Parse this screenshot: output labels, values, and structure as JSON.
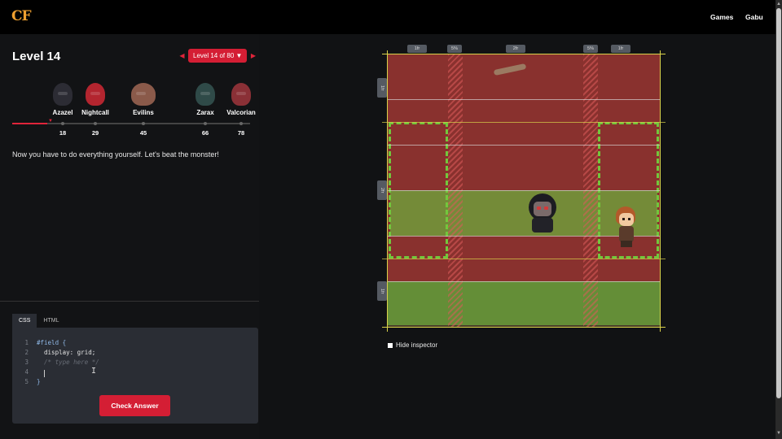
{
  "topbar": {
    "logo": "CF",
    "nav": [
      {
        "label": "Games"
      },
      {
        "label": "Gabu"
      }
    ]
  },
  "level": {
    "title": "Level 14",
    "selector_label": "Level 14 of 80",
    "dropdown_glyph": "▼",
    "prev_glyph": "◀",
    "next_glyph": "▶"
  },
  "bosses": [
    {
      "name": "Azazel",
      "level": "18",
      "color": "#2c2c34"
    },
    {
      "name": "Nightcall",
      "level": "29",
      "color": "#b3252f"
    },
    {
      "name": "Evilins",
      "level": "45",
      "color": "#8a5a4a"
    },
    {
      "name": "Zarax",
      "level": "66",
      "color": "#2f4a48"
    },
    {
      "name": "Valcorian",
      "level": "78",
      "color": "#8a3036"
    }
  ],
  "progress": {
    "current_level": 14,
    "total_levels": 80
  },
  "instructions": "Now you have to do everything yourself. Let's beat the monster!",
  "editor": {
    "tabs": [
      {
        "label": "CSS"
      },
      {
        "label": "HTML"
      }
    ],
    "active_tab": "CSS",
    "lines": [
      {
        "n": "1",
        "text": "#field {"
      },
      {
        "n": "2",
        "text": "  display: grid;"
      },
      {
        "n": "3",
        "text": "  /* type here */"
      },
      {
        "n": "4",
        "text": ""
      },
      {
        "n": "5",
        "text": "}"
      }
    ],
    "check_button": "Check Answer"
  },
  "inspector": {
    "column_tracks": [
      "1fr",
      "5%",
      "2fr",
      "5%",
      "1fr"
    ],
    "row_tracks": [
      "1fr",
      "2fr",
      "1fr"
    ],
    "hide_label": "Hide inspector"
  },
  "colors": {
    "accent": "#d41e34",
    "red_zone": "#be2832",
    "green_zone": "#6eaa3c",
    "grid_line": "#d9d24a"
  }
}
